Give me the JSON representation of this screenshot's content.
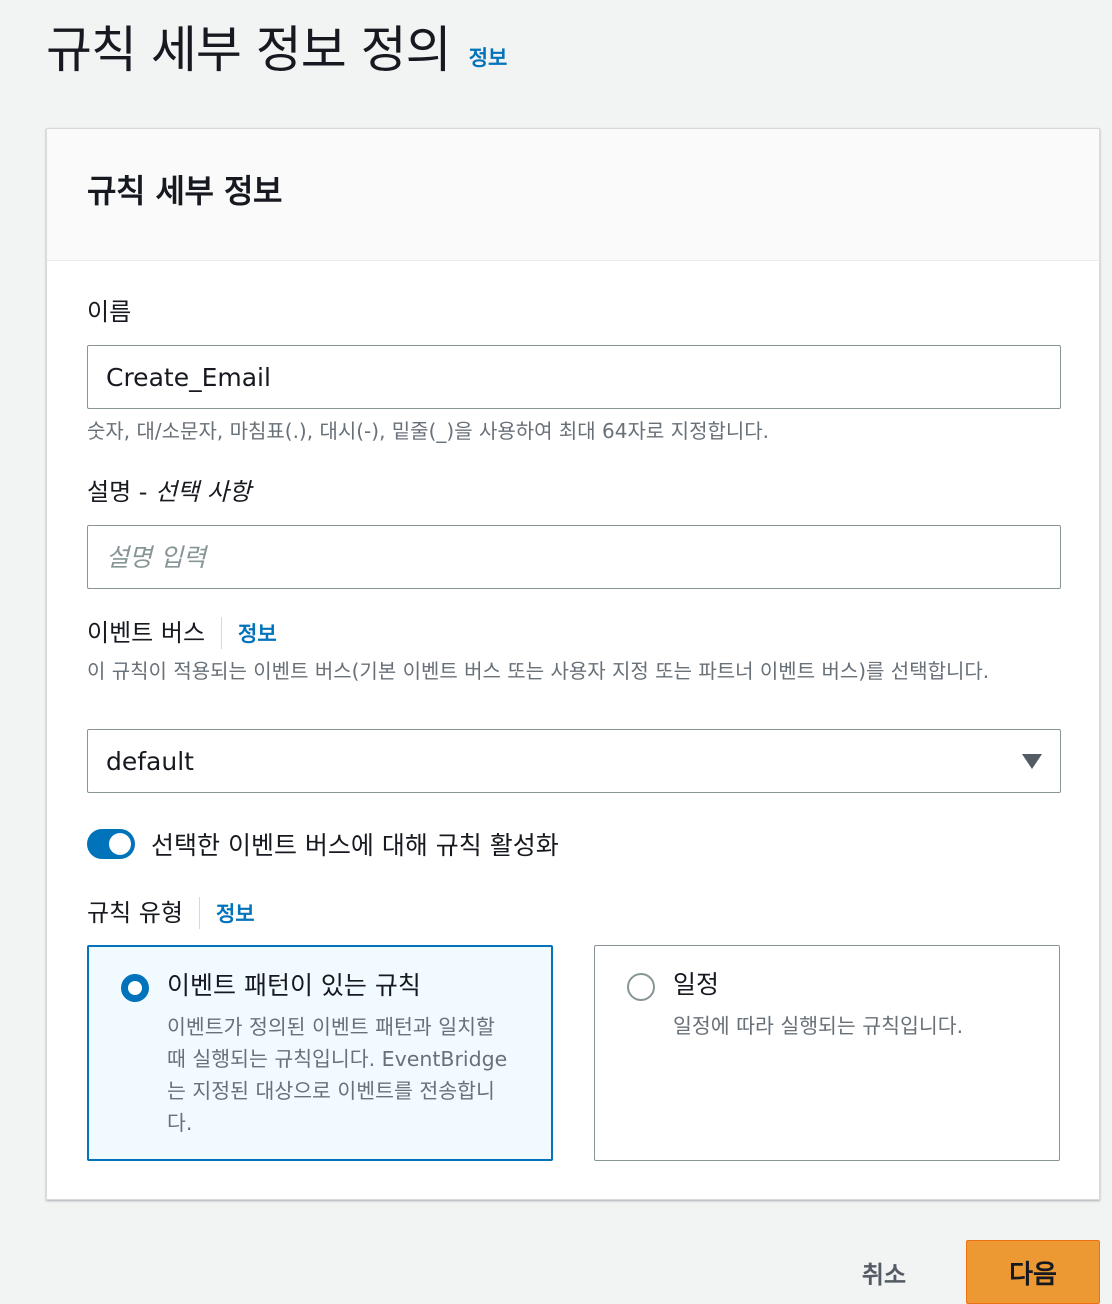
{
  "page": {
    "title": "규칙 세부 정보 정의",
    "info": "정보"
  },
  "panel": {
    "title": "규칙 세부 정보"
  },
  "name_field": {
    "label": "이름",
    "value": "Create_Email",
    "hint": "숫자, 대/소문자, 마침표(.), 대시(-), 밑줄(_)을 사용하여 최대 64자로 지정합니다."
  },
  "description_field": {
    "label": "설명 -",
    "optional": "선택 사항",
    "placeholder": "설명 입력"
  },
  "event_bus": {
    "label": "이벤트 버스",
    "info": "정보",
    "hint": "이 규칙이 적용되는 이벤트 버스(기본 이벤트 버스 또는 사용자 지정 또는 파트너 이벤트 버스)를 선택합니다.",
    "selected": "default"
  },
  "toggle": {
    "label": "선택한 이벤트 버스에 대해 규칙 활성화",
    "enabled": true
  },
  "rule_type": {
    "label": "규칙 유형",
    "info": "정보",
    "options": [
      {
        "title": "이벤트 패턴이 있는 규칙",
        "desc": "이벤트가 정의된 이벤트 패턴과 일치할 때 실행되는 규칙입니다. EventBridge는 지정된 대상으로 이벤트를 전송합니다.",
        "selected": true
      },
      {
        "title": "일정",
        "desc": "일정에 따라 실행되는 규칙입니다.",
        "selected": false
      }
    ]
  },
  "actions": {
    "cancel": "취소",
    "next": "다음"
  },
  "colors": {
    "accent": "#0073bb",
    "primary_button": "#ec9933",
    "selected_tile_bg": "#f1faff"
  }
}
